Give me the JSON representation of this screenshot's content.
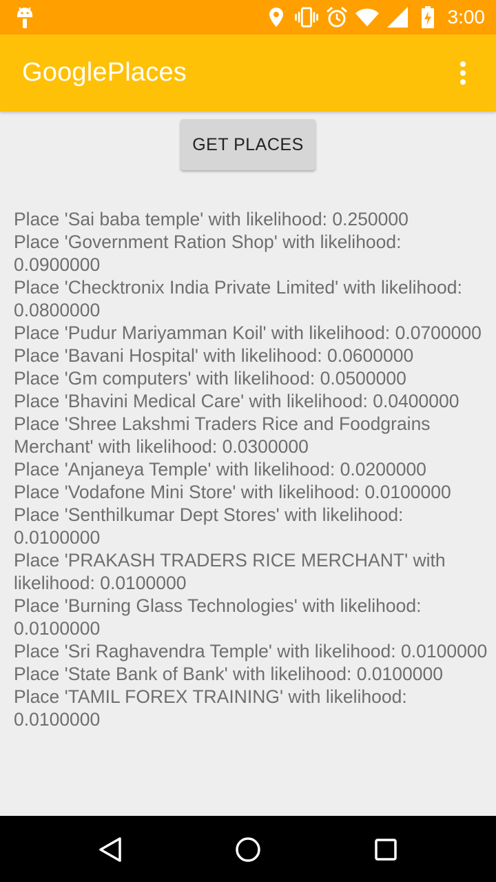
{
  "status_bar": {
    "time": "3:00",
    "icons": [
      "android-debug-icon",
      "location-icon",
      "vibrate-icon",
      "alarm-icon",
      "wifi-icon",
      "cell-signal-icon",
      "battery-charging-icon"
    ]
  },
  "app_bar": {
    "title": "GooglePlaces",
    "overflow_icon": "more-vert-icon"
  },
  "main": {
    "button_label": "GET PLACES",
    "results": [
      "Place 'Sai baba temple' with likelihood: 0.250000",
      "Place 'Government Ration Shop' with likelihood: 0.0900000",
      "Place 'Checktronix India Private Limited' with likelihood: 0.0800000",
      "Place 'Pudur Mariyamman Koil' with likelihood: 0.0700000",
      "Place 'Bavani Hospital' with likelihood: 0.0600000",
      "Place 'Gm computers' with likelihood: 0.0500000",
      "Place 'Bhavini Medical Care' with likelihood: 0.0400000",
      "Place 'Shree Lakshmi Traders Rice and Foodgrains Merchant' with likelihood: 0.0300000",
      "Place 'Anjaneya Temple' with likelihood: 0.0200000",
      "Place 'Vodafone Mini Store' with likelihood: 0.0100000",
      "Place 'Senthilkumar Dept Stores' with likelihood: 0.0100000",
      "Place 'PRAKASH TRADERS RICE MERCHANT' with likelihood: 0.0100000",
      "Place 'Burning Glass Technologies' with likelihood: 0.0100000",
      "Place 'Sri Raghavendra Temple' with likelihood: 0.0100000",
      "Place 'State Bank of Bank' with likelihood: 0.0100000",
      "Place 'TAMIL FOREX TRAINING' with likelihood: 0.0100000"
    ]
  },
  "nav_bar": {
    "icons": [
      "back-icon",
      "home-icon",
      "recents-icon"
    ]
  },
  "colors": {
    "status_bar": "#ffa000",
    "app_bar": "#ffc107",
    "background": "#eeeeee",
    "text": "#6e6e6e"
  }
}
